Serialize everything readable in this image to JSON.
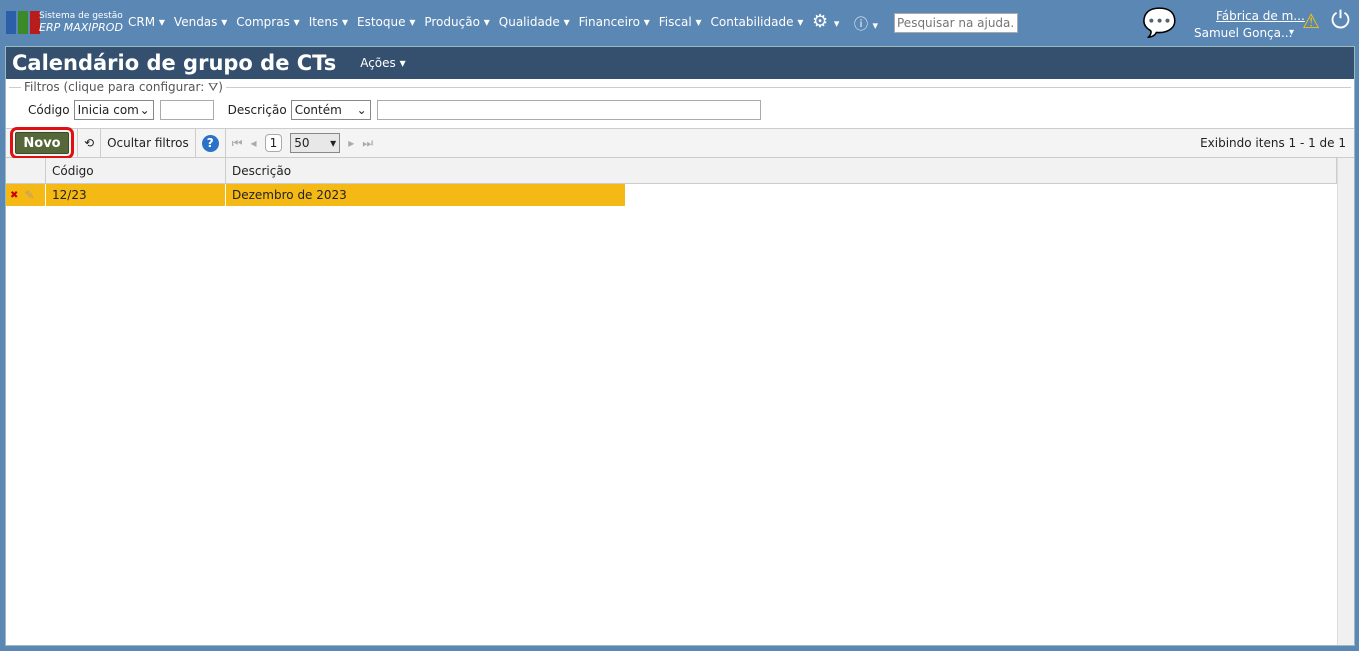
{
  "header": {
    "brand_line1": "Sistema de gestão",
    "brand_line2": "ERP MAXIPROD",
    "menu": [
      "CRM",
      "Vendas",
      "Compras",
      "Itens",
      "Estoque",
      "Produção",
      "Qualidade",
      "Financeiro",
      "Fiscal",
      "Contabilidade"
    ],
    "search_placeholder": "Pesquisar na ajuda...",
    "company": "Fábrica de m...",
    "user": "Samuel Gonça..."
  },
  "page": {
    "title": "Calendário de grupo de CTs",
    "actions": "Ações"
  },
  "filters": {
    "legend": "Filtros (clique para configurar:",
    "codigo_label": "Código",
    "codigo_op": "Inicia com",
    "descricao_label": "Descrição",
    "descricao_op": "Contém"
  },
  "toolbar": {
    "new": "Novo",
    "hide_filters": "Ocultar filtros",
    "page": "1",
    "page_size": "50",
    "status": "Exibindo itens 1 - 1 de 1"
  },
  "grid": {
    "columns": [
      "Código",
      "Descrição"
    ],
    "rows": [
      {
        "codigo": "12/23",
        "descricao": "Dezembro de 2023"
      }
    ]
  },
  "colors": {
    "topbar": "#5b87b5",
    "titlebar": "#34506e",
    "selected_row": "#f5b916",
    "new_button": "#56683a"
  }
}
